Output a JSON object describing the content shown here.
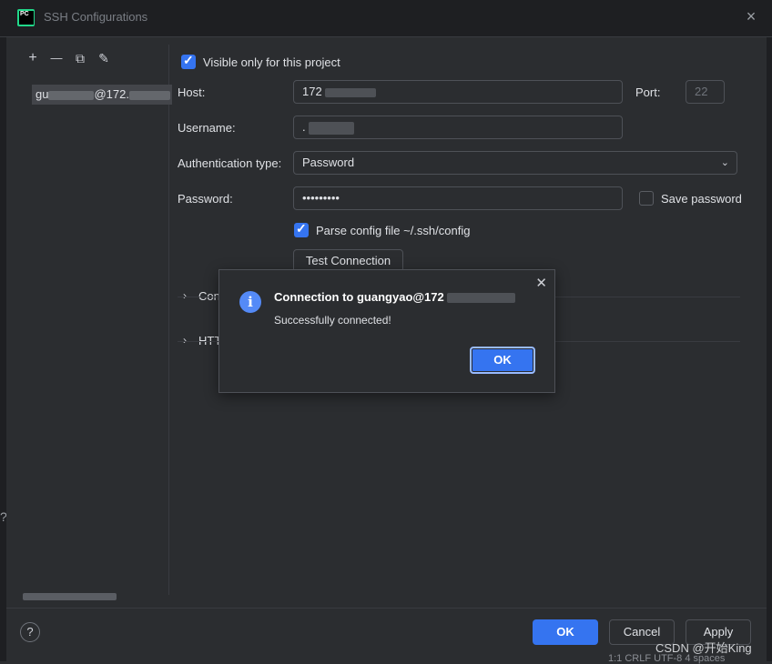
{
  "window": {
    "title": "SSH Configurations",
    "app_logo": "PC"
  },
  "left_panel": {
    "toolbar": [
      {
        "name": "add-icon",
        "glyph": "+"
      },
      {
        "name": "remove-icon",
        "glyph": "—"
      },
      {
        "name": "copy-icon",
        "glyph": "⧉"
      },
      {
        "name": "edit-icon",
        "glyph": "✎"
      }
    ],
    "config_item_prefix": "gu",
    "config_item_mid": "@172."
  },
  "form": {
    "visible_only_label": "Visible only for this project",
    "visible_only_checked": true,
    "host_label": "Host:",
    "host_value": "172",
    "port_label": "Port:",
    "port_placeholder": "22",
    "username_label": "Username:",
    "username_value": ".",
    "auth_label": "Authentication type:",
    "auth_value": "Password",
    "password_label": "Password:",
    "password_value": "•••••••••",
    "save_password_label": "Save password",
    "save_password_checked": false,
    "parse_config_label": "Parse config file ~/.ssh/config",
    "parse_config_checked": true,
    "test_connection_label": "Test Connection",
    "sections": [
      "Con",
      "HTT"
    ]
  },
  "popup": {
    "title": "Connection to guangyao@172",
    "message": "Successfully connected!",
    "ok_label": "OK"
  },
  "footer": {
    "help_label": "?",
    "ok_label": "OK",
    "cancel_label": "Cancel",
    "apply_label": "Apply"
  },
  "watermark": "CSDN @开始King",
  "statusbar": "1:1   CRLF   UTF-8   4 spaces",
  "colors": {
    "accent": "#3574f0",
    "background": "#2b2d30",
    "title_bg": "#1e1f22"
  }
}
